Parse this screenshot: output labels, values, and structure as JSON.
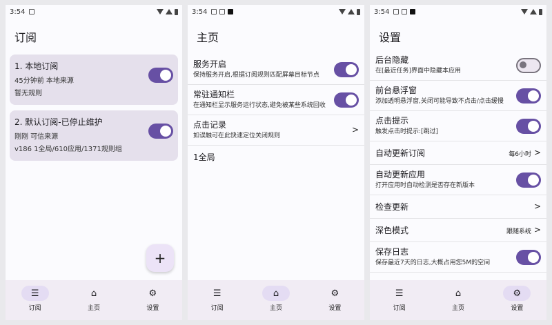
{
  "status": {
    "time": "3:54"
  },
  "screen1": {
    "title": "订阅",
    "cards": [
      {
        "title": "1. 本地订阅",
        "line1": "45分钟前   本地来源",
        "line2": "暂无规则",
        "enabled": true
      },
      {
        "title": "2. 默认订阅-已停止维护",
        "line1": "刚刚   可信来源",
        "line2": "v186   1全局/610应用/1371规则组",
        "enabled": true
      }
    ],
    "fab": "+"
  },
  "screen2": {
    "title": "主页",
    "rows": [
      {
        "title": "服务开启",
        "sub": "保持服务开启,根据订阅规则匹配屏幕目标节点",
        "toggle": true
      },
      {
        "title": "常驻通知栏",
        "sub": "在通知栏显示服务运行状态,避免被某些系统回收",
        "toggle": true
      },
      {
        "title": "点击记录",
        "sub": "如误触可在此快速定位关闭规则",
        "chevron": ">"
      }
    ],
    "footer": "1全局"
  },
  "screen3": {
    "title": "设置",
    "rows": [
      {
        "title": "后台隐藏",
        "sub": "在[最近任务]界面中隐藏本应用",
        "toggle": false
      },
      {
        "title": "前台悬浮窗",
        "sub": "添加透明悬浮窗,关闭可能导致不点击/点击缓慢",
        "toggle": true
      },
      {
        "title": "点击提示",
        "sub": "触发点击时提示:[跳过]",
        "toggle": true
      },
      {
        "title": "自动更新订阅",
        "value": "每6小时",
        "chevron": ">"
      },
      {
        "title": "自动更新应用",
        "sub": "打开应用时自动检测是否存在新版本",
        "toggle": true
      },
      {
        "title": "检查更新",
        "chevron": ">"
      },
      {
        "title": "深色模式",
        "value": "跟随系统",
        "chevron": ">"
      },
      {
        "title": "保存日志",
        "sub": "保存最近7天的日志,大概占用您5M的空间",
        "toggle": true
      }
    ]
  },
  "nav": {
    "items": [
      {
        "label": "订阅",
        "icon": "list-icon",
        "glyph": "☰"
      },
      {
        "label": "主页",
        "icon": "home-icon",
        "glyph": "⌂"
      },
      {
        "label": "设置",
        "icon": "gear-icon",
        "glyph": "⚙"
      }
    ]
  },
  "colors": {
    "accent": "#6750a4",
    "card": "#e5e0ec",
    "nav": "#f1ecf4"
  }
}
